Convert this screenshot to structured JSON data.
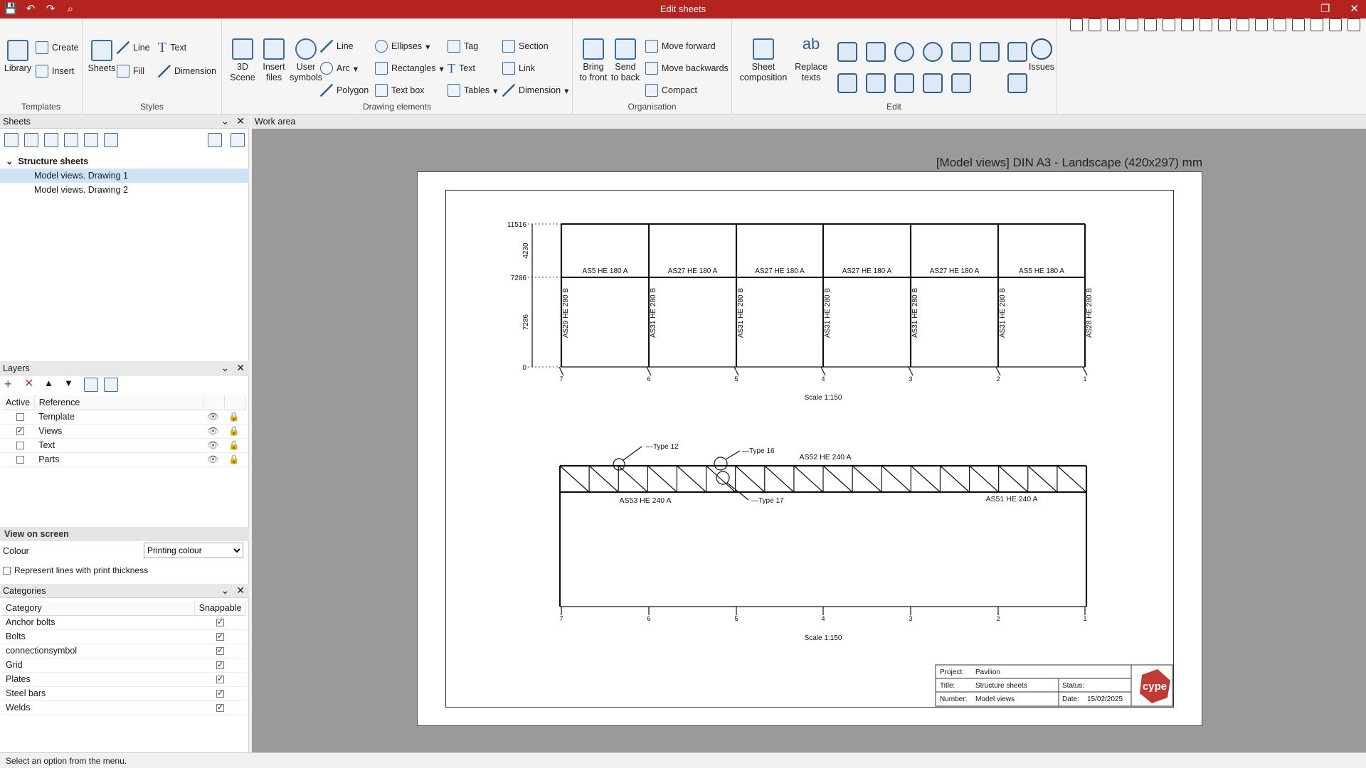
{
  "window": {
    "title": "Edit sheets"
  },
  "ribbon": {
    "templates": {
      "label": "Templates",
      "library": "Library",
      "create": "Create",
      "insert": "Insert"
    },
    "styles": {
      "label": "Styles",
      "sheets": "Sheets",
      "line": "Line",
      "text": "Text",
      "fill": "Fill",
      "dimension": "Dimension"
    },
    "drawing": {
      "label": "Drawing elements",
      "scene3d": "3D\nScene",
      "insert_files": "Insert\nfiles",
      "user_symbols": "User\nsymbols",
      "line": "Line",
      "arc": "Arc",
      "polygon": "Polygon",
      "ellipses": "Ellipses",
      "rectangles": "Rectangles",
      "text_box": "Text box",
      "tag": "Tag",
      "text": "Text",
      "tables": "Tables",
      "section": "Section",
      "link": "Link",
      "dimension": "Dimension"
    },
    "organisation": {
      "label": "Organisation",
      "bring_front": "Bring\nto front",
      "send_back": "Send\nto back",
      "move_forward": "Move forward",
      "move_backwards": "Move backwards",
      "compact": "Compact"
    },
    "edit": {
      "label": "Edit",
      "sheet_composition": "Sheet\ncomposition",
      "replace_texts": "Replace\ntexts",
      "issues": "Issues"
    }
  },
  "sheets_panel": {
    "title": "Sheets",
    "root": "Structure sheets",
    "items": [
      "Model views. Drawing 1",
      "Model views. Drawing 2"
    ]
  },
  "layers_panel": {
    "title": "Layers",
    "col_active": "Active",
    "col_reference": "Reference",
    "rows": [
      {
        "name": "Template",
        "active": false
      },
      {
        "name": "Views",
        "active": true
      },
      {
        "name": "Text",
        "active": false
      },
      {
        "name": "Parts",
        "active": false
      }
    ]
  },
  "view_on_screen": {
    "title": "View on screen",
    "colour_label": "Colour",
    "colour_value": "Printing colour",
    "thickness_label": "Represent lines with print thickness"
  },
  "categories_panel": {
    "title": "Categories",
    "col_category": "Category",
    "col_snappable": "Snappable",
    "rows": [
      "Anchor bolts",
      "Bolts",
      "connectionsymbol",
      "Grid",
      "Plates",
      "Steel bars",
      "Welds"
    ]
  },
  "work_area": {
    "title": "Work area",
    "sheet_info": "[Model views] DIN A3 - Landscape (420x297) mm"
  },
  "drawing1": {
    "levels": [
      "11516",
      "7286",
      "0"
    ],
    "dims": [
      "4230",
      "7286"
    ],
    "beams": [
      "AS5 HE 180 A",
      "AS27 HE 180 A",
      "AS27 HE 180 A",
      "AS27 HE 180 A",
      "AS27 HE 180 A",
      "AS5 HE 180 A"
    ],
    "columns": [
      "AS29 HE 280 B",
      "AS31 HE 280 B",
      "AS31 HE 280 B",
      "AS31 HE 280 B",
      "AS31 HE 280 B",
      "AS31 HE 280 B",
      "AS28 HE 280 B"
    ],
    "axes": [
      "7",
      "6",
      "5",
      "4",
      "3",
      "2",
      "1"
    ],
    "scale": "Scale 1:150"
  },
  "drawing2": {
    "tags": [
      "Type 12",
      "Type 16",
      "Type 17"
    ],
    "chords": [
      "AS52 HE 240 A",
      "AS53 HE 240 A",
      "AS51 HE 240 A"
    ],
    "axes": [
      "7",
      "6",
      "5",
      "4",
      "3",
      "2",
      "1"
    ],
    "scale": "Scale 1:150"
  },
  "title_block": {
    "project_label": "Project:",
    "project_value": "Pavilion",
    "title_label": "Title:",
    "title_value": "Structure sheets",
    "number_label": "Number:",
    "number_value": "Model views",
    "status_label": "Status:",
    "date_label": "Date:",
    "date_value": "15/02/2025",
    "logo": "cype"
  },
  "status": {
    "message": "Select an option from the menu."
  },
  "colors": {
    "titlebar": "#b5231f",
    "accent": "#3a6da8",
    "logo": "#c23a34"
  }
}
